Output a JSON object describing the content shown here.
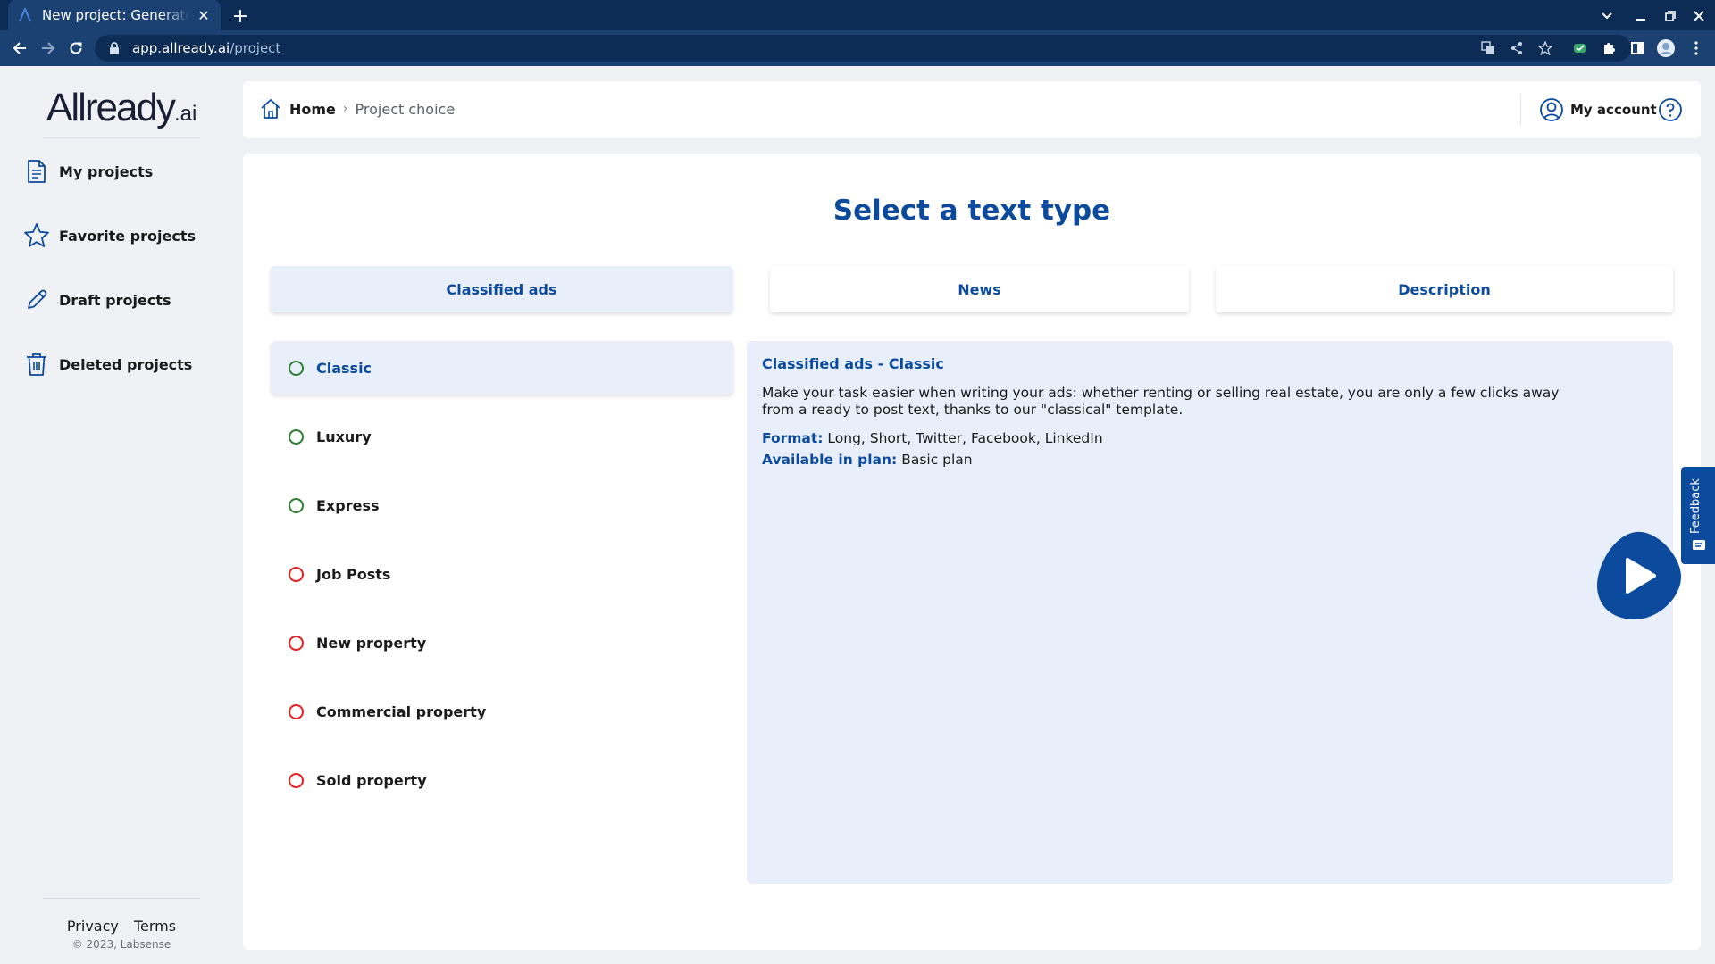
{
  "browser": {
    "tab_title": "New project: Generate co",
    "url_host": "app.allready.ai",
    "url_path": "/project"
  },
  "sidebar": {
    "logo_main": "Allready",
    "logo_tld": ".ai",
    "items": [
      {
        "label": "My projects",
        "icon": "document-icon"
      },
      {
        "label": "Favorite projects",
        "icon": "star-icon"
      },
      {
        "label": "Draft projects",
        "icon": "pencil-icon"
      },
      {
        "label": "Deleted projects",
        "icon": "trash-icon"
      }
    ],
    "footer": {
      "privacy": "Privacy",
      "terms": "Terms",
      "copyright": "© 2023, Labsense"
    }
  },
  "header": {
    "home_label": "Home",
    "separator": "›",
    "current": "Project choice",
    "account_label": "My account"
  },
  "main": {
    "title": "Select a text type",
    "tabs": [
      {
        "label": "Classified ads",
        "active": true
      },
      {
        "label": "News",
        "active": false
      },
      {
        "label": "Description",
        "active": false
      }
    ],
    "options": [
      {
        "label": "Classic",
        "status": "green",
        "selected": true
      },
      {
        "label": "Luxury",
        "status": "green",
        "selected": false
      },
      {
        "label": "Express",
        "status": "green",
        "selected": false
      },
      {
        "label": "Job Posts",
        "status": "red",
        "selected": false
      },
      {
        "label": "New property",
        "status": "red",
        "selected": false
      },
      {
        "label": "Commercial property",
        "status": "red",
        "selected": false
      },
      {
        "label": "Sold property",
        "status": "red",
        "selected": false
      }
    ],
    "detail": {
      "title": "Classified ads - Classic",
      "description": "Make your task easier when writing your ads: whether renting or selling real estate, you are only a few clicks away from a ready to post text, thanks to our \"classical\" template.",
      "format_key": "Format:",
      "format_value": " Long, Short, Twitter, Facebook, LinkedIn",
      "plan_key": "Available in plan:",
      "plan_value": " Basic plan"
    }
  },
  "feedback_label": "Feedback",
  "colors": {
    "brand_blue": "#0b4a9c",
    "panel_bg": "#e8effb",
    "radio_green": "#2e7d32",
    "radio_red": "#e32020",
    "chrome_dark": "#0c2c55",
    "chrome_mid": "#1a4172"
  }
}
